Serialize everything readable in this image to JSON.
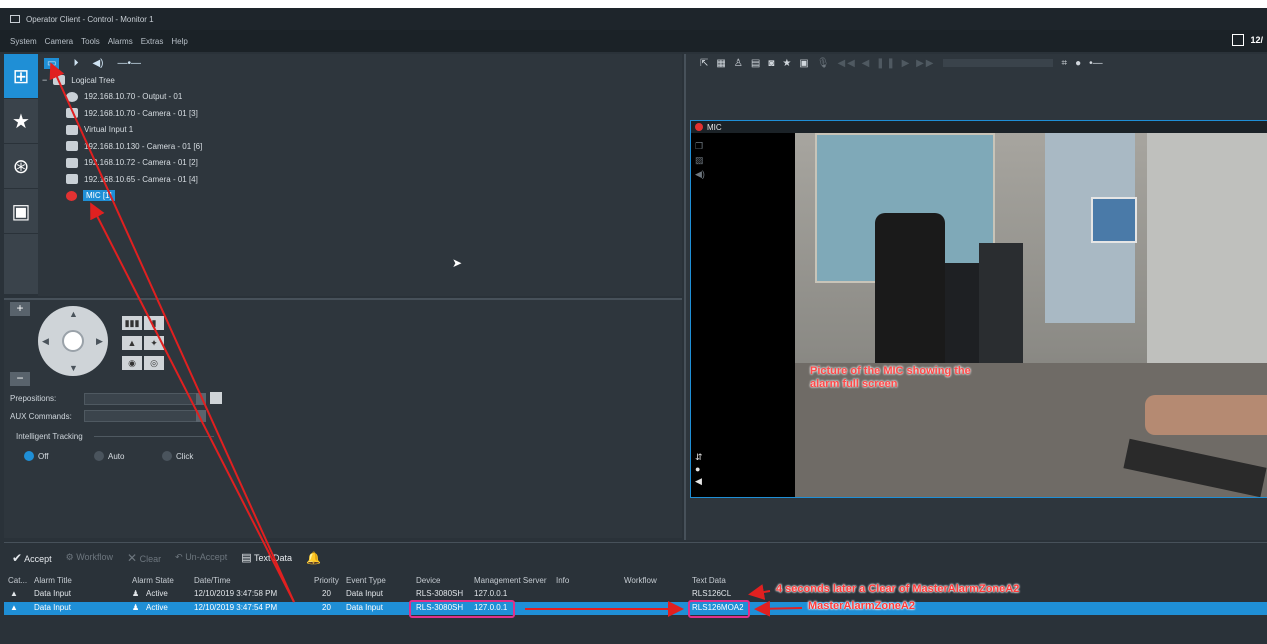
{
  "window": {
    "title": "Operator Client - Control - Monitor 1"
  },
  "menu": {
    "items": [
      "System",
      "Camera",
      "Tools",
      "Alarms",
      "Extras",
      "Help"
    ],
    "right_text": "12/"
  },
  "sidebar": {
    "items": [
      "logical-tree",
      "favorites",
      "maps",
      "monitors"
    ]
  },
  "tree": {
    "root_label": "Logical Tree",
    "items": [
      {
        "label": "192.168.10.70 - Output - 01",
        "icon": "output-icon"
      },
      {
        "label": "192.168.10.70 - Camera - 01 [3]",
        "icon": "camera-icon"
      },
      {
        "label": "Virtual Input 1",
        "icon": "virtual-input-icon"
      },
      {
        "label": "192.168.10.130 - Camera - 01 [6]",
        "icon": "dome-camera-icon"
      },
      {
        "label": "192.168.10.72 - Camera - 01 [2]",
        "icon": "camera-icon"
      },
      {
        "label": "192.168.10.65 - Camera - 01 [4]",
        "icon": "camera-icon"
      },
      {
        "label": "MIC [1]",
        "icon": "mic-camera-icon",
        "selected": true
      }
    ]
  },
  "ptz": {
    "prepositions_label": "Prepositions:",
    "aux_label": "AUX Commands:",
    "tracking_label": "Intelligent Tracking",
    "tracking_options": [
      {
        "label": "Off",
        "selected": true
      },
      {
        "label": "Auto",
        "selected": false
      },
      {
        "label": "Click",
        "selected": false
      }
    ],
    "zoom_plus": "+",
    "zoom_minus": "−"
  },
  "video": {
    "camera_name": "MIC",
    "annotation": "Picture of the MIC showing the alarm full screen"
  },
  "alarm_toolbar": {
    "accept": "Accept",
    "workflow": "Workflow",
    "clear": "Clear",
    "unaccept": "Un-Accept",
    "text_data": "Text Data"
  },
  "alarm_table": {
    "headers": [
      "Cat...",
      "Alarm Title",
      "Alarm State",
      "Date/Time",
      "Priority",
      "Event Type",
      "Device",
      "Management Server",
      "Info",
      "Workflow",
      "Text Data"
    ],
    "rows": [
      {
        "title": "Data Input",
        "state": "Active",
        "datetime": "12/10/2019 3:47:58 PM",
        "priority": "20",
        "event_type": "Data Input",
        "device": "RLS-3080SH",
        "server": "127.0.0.1",
        "info": "",
        "workflow": "",
        "text_data": "RLS126CL",
        "selected": false
      },
      {
        "title": "Data Input",
        "state": "Active",
        "datetime": "12/10/2019 3:47:54 PM",
        "priority": "20",
        "event_type": "Data Input",
        "device": "RLS-3080SH",
        "server": "127.0.0.1",
        "info": "",
        "workflow": "",
        "text_data": "RLS126MOA2",
        "selected": true
      }
    ]
  },
  "annotations": {
    "clear_note": "4 seconds later a Clear of MasterAlarmZoneA2",
    "alarm_note": "MasterAlarmZoneA2"
  },
  "colors": {
    "accent": "#1f8fd6",
    "annotation": "#ff3b3b",
    "highlight": "#e0308a"
  }
}
